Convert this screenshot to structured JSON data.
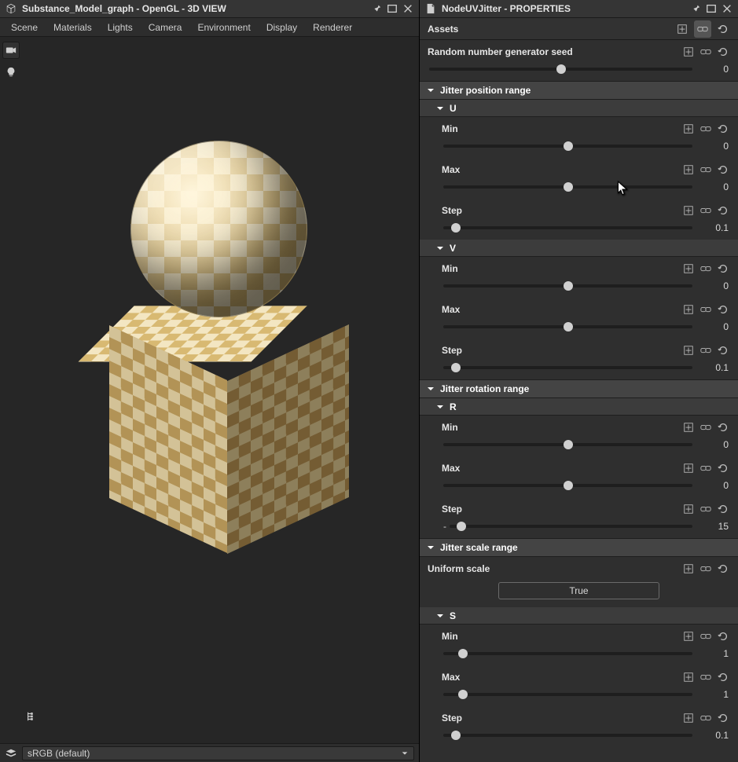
{
  "left": {
    "title": "Substance_Model_graph - OpenGL - 3D VIEW",
    "menu": [
      "Scene",
      "Materials",
      "Lights",
      "Camera",
      "Environment",
      "Display",
      "Renderer"
    ],
    "status_dropdown": "sRGB (default)"
  },
  "right": {
    "title": "NodeUVJitter - PROPERTIES",
    "assets_label": "Assets",
    "seed": {
      "label": "Random number generator seed",
      "value": "0",
      "pos": 50
    },
    "sec_position": "Jitter position range",
    "sub_U": "U",
    "u_min": {
      "label": "Min",
      "value": "0",
      "pos": 50
    },
    "u_max": {
      "label": "Max",
      "value": "0",
      "pos": 50
    },
    "u_step": {
      "label": "Step",
      "value": "0.1",
      "pos": 5
    },
    "sub_V": "V",
    "v_min": {
      "label": "Min",
      "value": "0",
      "pos": 50
    },
    "v_max": {
      "label": "Max",
      "value": "0",
      "pos": 50
    },
    "v_step": {
      "label": "Step",
      "value": "0.1",
      "pos": 5
    },
    "sec_rotation": "Jitter rotation range",
    "sub_R": "R",
    "r_min": {
      "label": "Min",
      "value": "0",
      "pos": 50
    },
    "r_max": {
      "label": "Max",
      "value": "0",
      "pos": 50
    },
    "r_step": {
      "label": "Step",
      "value": "15",
      "pos": 5,
      "neg": true
    },
    "sec_scale": "Jitter scale range",
    "uniform": {
      "label": "Uniform scale",
      "value": "True"
    },
    "sub_S": "S",
    "s_min": {
      "label": "Min",
      "value": "1",
      "pos": 8
    },
    "s_max": {
      "label": "Max",
      "value": "1",
      "pos": 8
    },
    "s_step": {
      "label": "Step",
      "value": "0.1",
      "pos": 5
    }
  }
}
